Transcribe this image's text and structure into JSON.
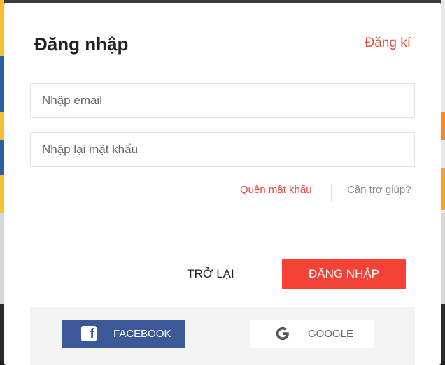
{
  "login_modal": {
    "title": "Đăng nhập",
    "register_link": "Đăng kí",
    "email_placeholder": "Nhập email",
    "password_placeholder": "Nhập lại mật khẩu",
    "forgot_password_link": "Quên mật khẩu",
    "help_link": "Cần trợ giúp?",
    "back_button": "TRỞ LẠI",
    "login_button": "ĐĂNG NHẬP"
  },
  "social_login": {
    "facebook_label": "FACEBOOK",
    "facebook_icon": "facebook-icon",
    "google_label": "GOOGLE",
    "google_icon": "google-icon"
  },
  "colors": {
    "accent": "#f44336",
    "link_red": "#e94b3c",
    "facebook_blue": "#3b5998"
  }
}
